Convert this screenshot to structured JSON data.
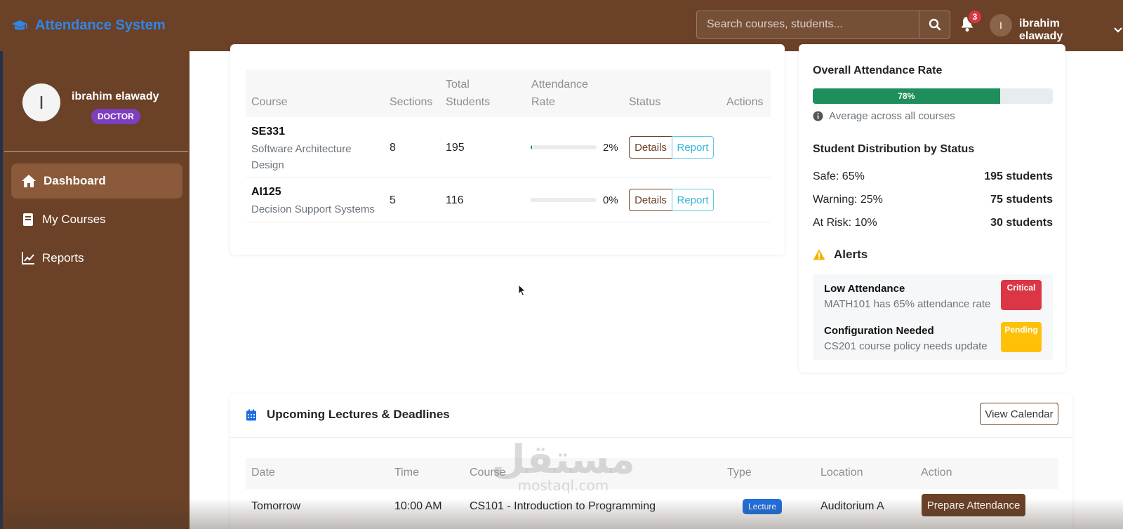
{
  "app": {
    "title": "Attendance System"
  },
  "header": {
    "search_placeholder": "Search courses, students...",
    "notification_count": "3",
    "user_initial": "I",
    "user_name": "ibrahim elawady"
  },
  "sidebar": {
    "profile": {
      "initial": "I",
      "name": "ibrahim elawady",
      "role": "DOCTOR"
    },
    "items": [
      {
        "label": "Dashboard",
        "icon": "home-icon",
        "active": true
      },
      {
        "label": "My Courses",
        "icon": "book-icon",
        "active": false
      },
      {
        "label": "Reports",
        "icon": "chart-line-icon",
        "active": false
      }
    ]
  },
  "courses_table": {
    "headers": {
      "course": "Course",
      "sections": "Sections",
      "total_students": "Total Students",
      "attendance_rate": "Attendance Rate",
      "status": "Status",
      "actions": "Actions"
    },
    "rows": [
      {
        "code": "SE331",
        "name": "Software Architecture Design",
        "sections": "8",
        "students": "195",
        "rate_label": "2%",
        "rate": 0.02,
        "details": "Details",
        "report": "Report"
      },
      {
        "code": "AI125",
        "name": "Decision Support Systems",
        "sections": "5",
        "students": "116",
        "rate_label": "0%",
        "rate": 0,
        "details": "Details",
        "report": "Report"
      }
    ]
  },
  "overview": {
    "overall_title": "Overall Attendance Rate",
    "overall_label": "78%",
    "overall_value": 0.78,
    "overall_note": "Average across all courses",
    "distribution_title": "Student Distribution by Status",
    "distribution": [
      {
        "label": "Safe: 65%",
        "count": "195 students"
      },
      {
        "label": "Warning: 25%",
        "count": "75 students"
      },
      {
        "label": "At Risk: 10%",
        "count": "30 students"
      }
    ],
    "alerts_title": "Alerts",
    "alerts": [
      {
        "title": "Low Attendance",
        "message": "MATH101 has 65% attendance rate",
        "tag": "Critical",
        "tag_color": "#dc3545"
      },
      {
        "title": "Configuration Needed",
        "message": "CS201 course policy needs update",
        "tag": "Pending",
        "tag_color": "#ffc107"
      }
    ]
  },
  "upcoming": {
    "title": "Upcoming Lectures & Deadlines",
    "view_calendar": "View Calendar",
    "headers": {
      "date": "Date",
      "time": "Time",
      "course": "Course",
      "type": "Type",
      "location": "Location",
      "action": "Action"
    },
    "rows": [
      {
        "date": "Tomorrow",
        "time": "10:00 AM",
        "course": "CS101 - Introduction to Programming",
        "type": "Lecture",
        "location": "Auditorium A",
        "action": "Prepare Attendance"
      }
    ]
  },
  "watermark": {
    "arabic": "مستقل",
    "latin": "mostaql.com"
  },
  "colors": {
    "brand_brown": "#6b4127",
    "brand_blue": "#2f86e8",
    "success": "#1e8e5a",
    "danger": "#dc3545",
    "warning": "#ffc107",
    "role_purple": "#7d3fbf"
  }
}
